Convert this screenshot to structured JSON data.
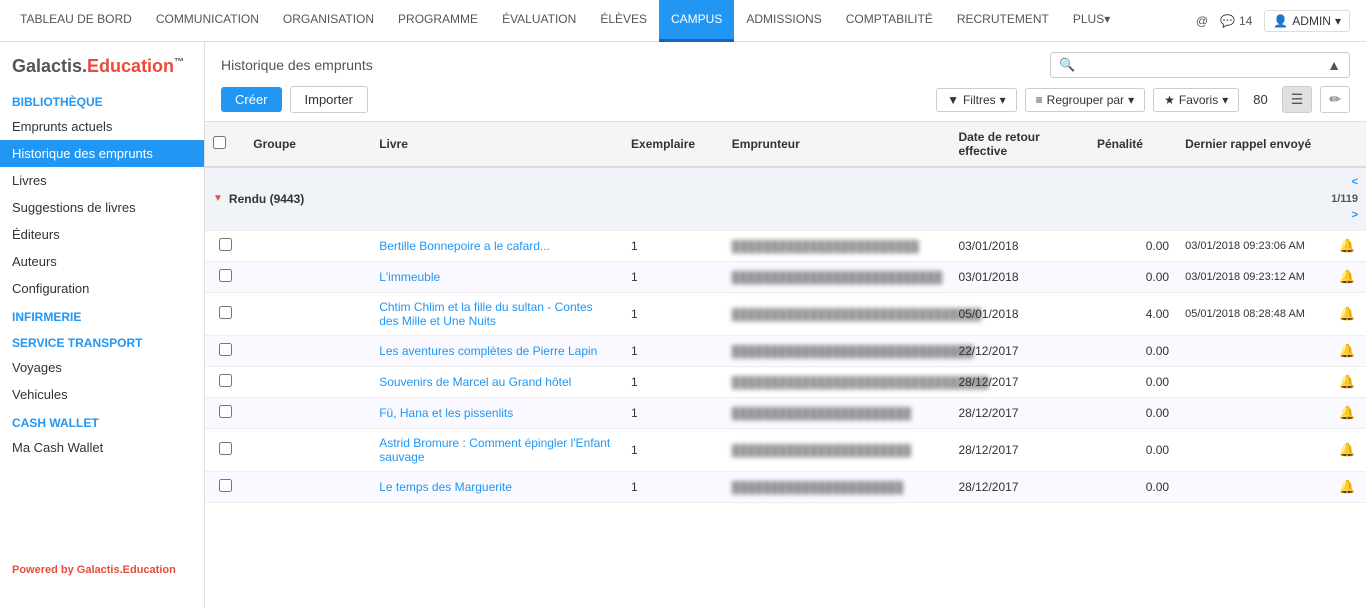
{
  "nav": {
    "items": [
      {
        "label": "TABLEAU DE BORD",
        "active": false
      },
      {
        "label": "COMMUNICATION",
        "active": false
      },
      {
        "label": "ORGANISATION",
        "active": false
      },
      {
        "label": "PROGRAMME",
        "active": false
      },
      {
        "label": "ÉVALUATION",
        "active": false
      },
      {
        "label": "ÉLÈVES",
        "active": false
      },
      {
        "label": "CAMPUS",
        "active": true
      },
      {
        "label": "ADMISSIONS",
        "active": false
      },
      {
        "label": "COMPTABILITÉ",
        "active": false
      },
      {
        "label": "RECRUTEMENT",
        "active": false
      },
      {
        "label": "PLUS",
        "active": false,
        "dropdown": true
      }
    ],
    "message_count": "14",
    "admin_label": "ADMIN"
  },
  "sidebar": {
    "logo_galactis": "Galactis.",
    "logo_education": "Education",
    "logo_tm": "™",
    "sections": [
      {
        "title": "BIBLIOTHÈQUE",
        "items": [
          {
            "label": "Emprunts actuels",
            "active": false
          },
          {
            "label": "Historique des emprunts",
            "active": true
          },
          {
            "label": "Livres",
            "active": false
          },
          {
            "label": "Suggestions de livres",
            "active": false
          },
          {
            "label": "Éditeurs",
            "active": false
          },
          {
            "label": "Auteurs",
            "active": false
          },
          {
            "label": "Configuration",
            "active": false
          }
        ]
      },
      {
        "title": "INFIRMERIE",
        "items": []
      },
      {
        "title": "SERVICE TRANSPORT",
        "items": [
          {
            "label": "Voyages",
            "active": false
          },
          {
            "label": "Vehicules",
            "active": false
          }
        ]
      },
      {
        "title": "CASH WALLET",
        "items": [
          {
            "label": "Ma Cash Wallet",
            "active": false
          }
        ]
      }
    ],
    "footer": "Powered by Galactis.Education"
  },
  "toolbar": {
    "page_title": "Historique des emprunts",
    "create_label": "Créer",
    "import_label": "Importer",
    "filter_label": "Filtres",
    "group_label": "Regrouper par",
    "favorites_label": "Favoris",
    "record_count": "80",
    "search_placeholder": ""
  },
  "table": {
    "columns": [
      {
        "label": "Groupe"
      },
      {
        "label": "Livre"
      },
      {
        "label": "Exemplaire"
      },
      {
        "label": "Emprunteur"
      },
      {
        "label": "Date de retour effective"
      },
      {
        "label": "Pénalité"
      },
      {
        "label": "Dernier rappel envoyé"
      }
    ],
    "group_name": "Rendu (9443)",
    "pagination": {
      "current": "1/119",
      "prev": "<",
      "next": ">"
    },
    "rows": [
      {
        "livre": "Bertille Bonnepoire a le cafard...",
        "exemplaire": "1",
        "emprunteur": "████████████████████████",
        "date_retour": "03/01/2018",
        "penalite": "0.00",
        "rappel": "03/01/2018 09:23:06 AM"
      },
      {
        "livre": "L'immeuble",
        "exemplaire": "1",
        "emprunteur": "███████████████████████████",
        "date_retour": "03/01/2018",
        "penalite": "0.00",
        "rappel": "03/01/2018 09:23:12 AM"
      },
      {
        "livre": "Chtim Chlim et la fille du sultan - Contes des Mille et Une Nuits",
        "exemplaire": "1",
        "emprunteur": "████████████████████████████████",
        "date_retour": "05/01/2018",
        "penalite": "4.00",
        "rappel": "05/01/2018 08:28:48 AM"
      },
      {
        "livre": "Les aventures complètes de Pierre Lapin",
        "exemplaire": "1",
        "emprunteur": "███████████████████████████████",
        "date_retour": "22/12/2017",
        "penalite": "0.00",
        "rappel": ""
      },
      {
        "livre": "Souvenirs de Marcel au Grand hôtel",
        "exemplaire": "1",
        "emprunteur": "█████████████████████████████████",
        "date_retour": "28/12/2017",
        "penalite": "0.00",
        "rappel": ""
      },
      {
        "livre": "Fü, Hana et les pissenlits",
        "exemplaire": "1",
        "emprunteur": "███████████████████████",
        "date_retour": "28/12/2017",
        "penalite": "0.00",
        "rappel": ""
      },
      {
        "livre": "Astrid Bromure : Comment épingler l'Enfant sauvage",
        "exemplaire": "1",
        "emprunteur": "███████████████████████",
        "date_retour": "28/12/2017",
        "penalite": "0.00",
        "rappel": ""
      },
      {
        "livre": "Le temps des Marguerite",
        "exemplaire": "1",
        "emprunteur": "██████████████████████",
        "date_retour": "28/12/2017",
        "penalite": "0.00",
        "rappel": ""
      }
    ]
  }
}
